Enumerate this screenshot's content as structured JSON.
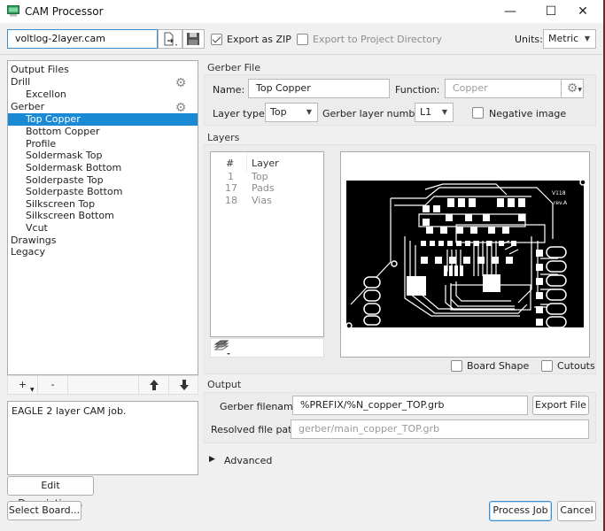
{
  "window": {
    "title": "CAM Processor",
    "controls": {
      "minimize": "—",
      "maximize": "☐",
      "close": "✕"
    }
  },
  "toolbar": {
    "job_file": "voltlog-2layer.cam",
    "export_zip_label": "Export as ZIP",
    "export_zip_checked": true,
    "export_project_label": "Export to Project Directory",
    "export_project_checked": false,
    "units_label": "Units:",
    "units_value": "Metric"
  },
  "tree": {
    "header": "Output Files",
    "items": [
      {
        "label": "Drill",
        "level": 0,
        "gear": true
      },
      {
        "label": "Excellon",
        "level": 1
      },
      {
        "label": "Gerber",
        "level": 0,
        "gear": true
      },
      {
        "label": "Top Copper",
        "level": 1,
        "selected": true
      },
      {
        "label": "Bottom Copper",
        "level": 1
      },
      {
        "label": "Profile",
        "level": 1
      },
      {
        "label": "Soldermask Top",
        "level": 1
      },
      {
        "label": "Soldermask Bottom",
        "level": 1
      },
      {
        "label": "Solderpaste Top",
        "level": 1
      },
      {
        "label": "Solderpaste Bottom",
        "level": 1
      },
      {
        "label": "Silkscreen Top",
        "level": 1
      },
      {
        "label": "Silkscreen Bottom",
        "level": 1
      },
      {
        "label": "Vcut",
        "level": 1
      },
      {
        "label": "Drawings",
        "level": 0
      },
      {
        "label": "Legacy",
        "level": 0
      }
    ],
    "buttons": {
      "add": "+",
      "remove": "-",
      "up": "🡅",
      "down": "🡇"
    }
  },
  "description": {
    "text": "EAGLE 2 layer CAM job.",
    "edit_button": "Edit Description...",
    "select_board_button": "Select Board..."
  },
  "gerber_file": {
    "section_title": "Gerber File",
    "name_label": "Name:",
    "name_value": "Top Copper",
    "function_label": "Function:",
    "function_value": "Copper",
    "layer_type_label": "Layer type:",
    "layer_type_value": "Top",
    "gerber_layer_number_label": "Gerber layer number:",
    "gerber_layer_number_value": "L1",
    "negative_image_label": "Negative image",
    "negative_image_checked": false
  },
  "layers": {
    "section_title": "Layers",
    "columns": [
      "#",
      "Layer"
    ],
    "rows": [
      {
        "num": "1",
        "name": "Top"
      },
      {
        "num": "17",
        "name": "Pads"
      },
      {
        "num": "18",
        "name": "Vias"
      }
    ],
    "board_shape_label": "Board Shape",
    "board_shape_checked": false,
    "cutouts_label": "Cutouts",
    "cutouts_checked": false,
    "preview_silk_text": [
      "V118",
      "rev.A"
    ]
  },
  "output": {
    "section_title": "Output",
    "gerber_filename_label": "Gerber filename:",
    "gerber_filename_value": "%PREFIX/%N_copper_TOP.grb",
    "export_file_button": "Export File",
    "resolved_path_label": "Resolved file path:",
    "resolved_path_value": "gerber/main_copper_TOP.grb"
  },
  "advanced": {
    "label": "Advanced",
    "expanded": false
  },
  "footer": {
    "process_button": "Process Job",
    "cancel_button": "Cancel"
  }
}
